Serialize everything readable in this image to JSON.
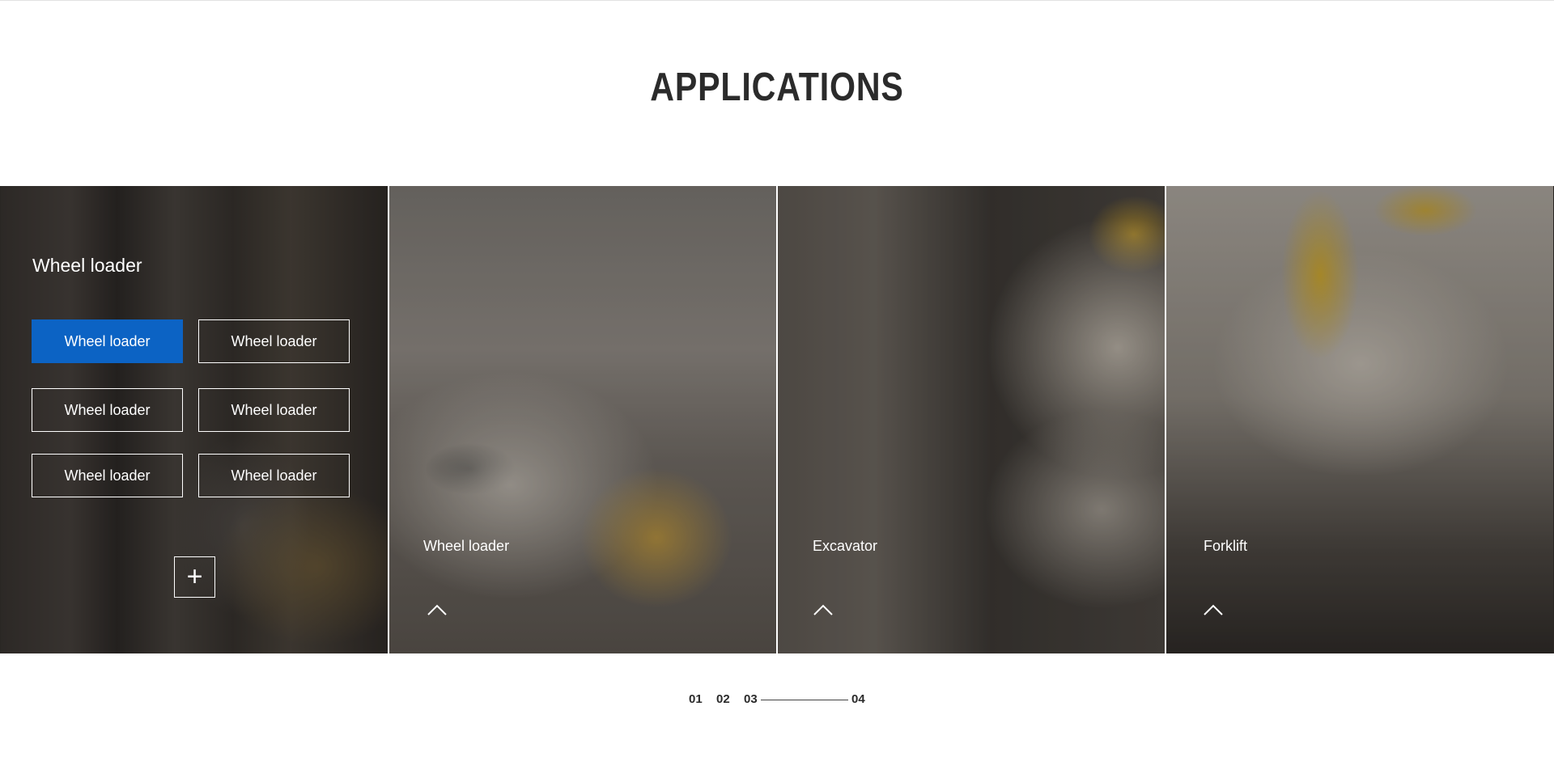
{
  "section": {
    "title": "APPLICATIONS"
  },
  "panels": [
    {
      "title": "Wheel loader",
      "buttons": [
        {
          "label": "Wheel loader",
          "active": true
        },
        {
          "label": "Wheel loader",
          "active": false
        },
        {
          "label": "Wheel loader",
          "active": false
        },
        {
          "label": "Wheel loader",
          "active": false
        },
        {
          "label": "Wheel loader",
          "active": false
        },
        {
          "label": "Wheel loader",
          "active": false
        }
      ],
      "more_icon": "plus-icon",
      "more_symbol": "+"
    },
    {
      "label": "Wheel loader",
      "icon": "chevron-up-icon"
    },
    {
      "label": "Excavator",
      "icon": "chevron-up-icon"
    },
    {
      "label": "Forklift",
      "icon": "chevron-up-icon"
    }
  ],
  "pager": {
    "items": [
      "01",
      "02",
      "03",
      "04"
    ],
    "active_index": 3
  },
  "colors": {
    "accent": "#0c63c4",
    "title": "#2b2b2b"
  }
}
